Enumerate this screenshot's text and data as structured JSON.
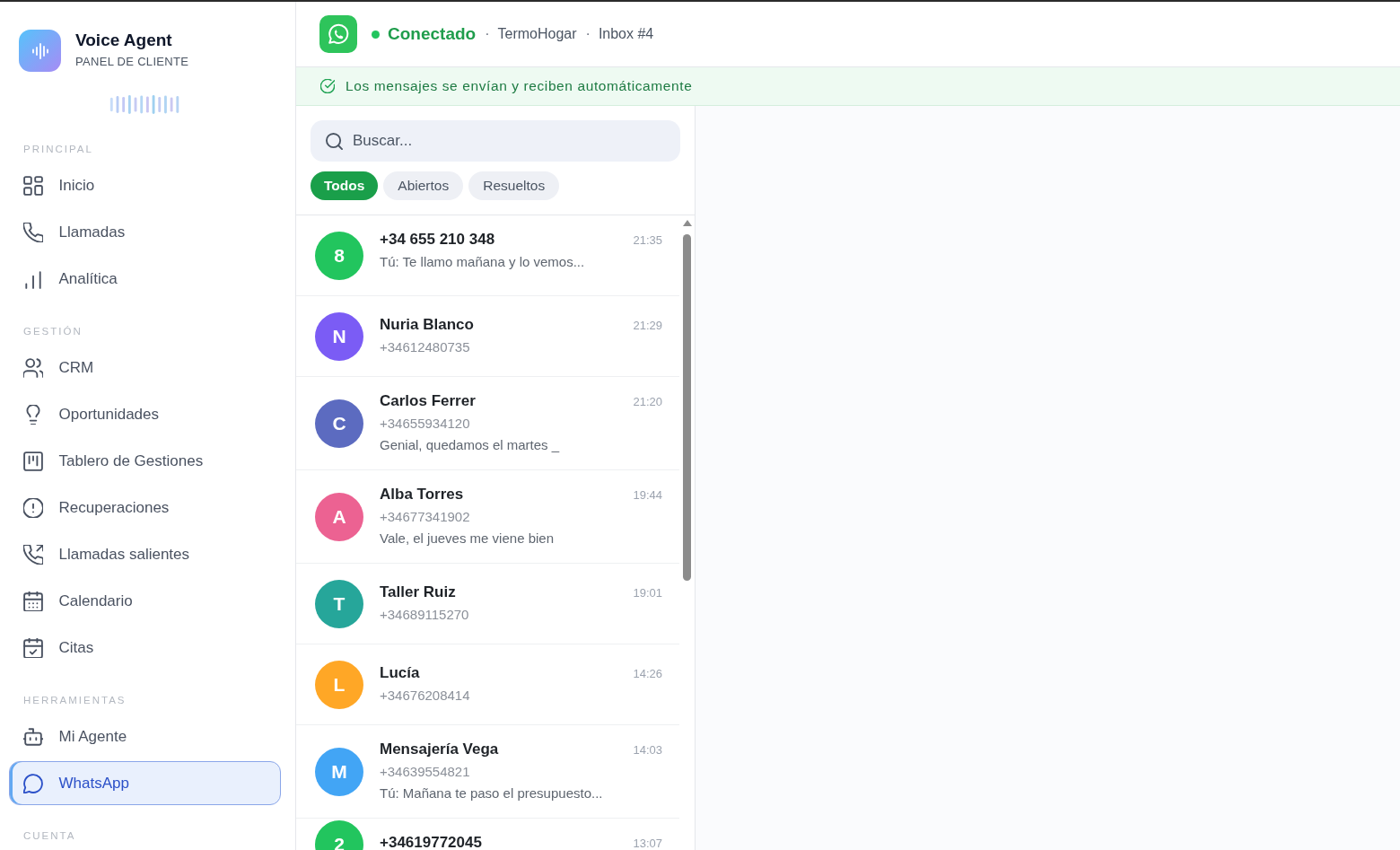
{
  "sidebar": {
    "brand": {
      "title": "Voice Agent",
      "subtitle": "PANEL DE CLIENTE"
    },
    "sections": [
      {
        "label": "PRINCIPAL",
        "items": [
          {
            "label": "Inicio",
            "selected": false
          },
          {
            "label": "Llamadas",
            "selected": false
          },
          {
            "label": "Analítica",
            "selected": false
          }
        ]
      },
      {
        "label": "GESTIÓN",
        "items": [
          {
            "label": "CRM",
            "selected": false
          },
          {
            "label": "Oportunidades",
            "selected": false
          },
          {
            "label": "Tablero de Gestiones",
            "selected": false
          },
          {
            "label": "Recuperaciones",
            "selected": false
          },
          {
            "label": "Llamadas salientes",
            "selected": false
          },
          {
            "label": "Calendario",
            "selected": false
          },
          {
            "label": "Citas",
            "selected": false
          }
        ]
      },
      {
        "label": "HERRAMIENTAS",
        "items": [
          {
            "label": "Mi Agente",
            "selected": false
          },
          {
            "label": "WhatsApp",
            "selected": true
          }
        ]
      },
      {
        "label": "CUENTA"
      }
    ]
  },
  "header": {
    "status": "Conectado",
    "connected": true,
    "breadcrumb": [
      {
        "separator": "·",
        "text": "TermoHogar"
      },
      {
        "separator": "·",
        "text": "Inbox #4"
      }
    ]
  },
  "banner": {
    "text": "Los mensajes se envían y reciben automáticamente"
  },
  "search": {
    "placeholder": "Buscar..."
  },
  "filters": [
    {
      "label": "Todos",
      "selected": true
    },
    {
      "label": "Abiertos",
      "selected": false
    },
    {
      "label": "Resueltos",
      "selected": false
    }
  ],
  "conversations": [
    {
      "initial": "8",
      "color": "#22c55e",
      "name": "+34 655 210 348",
      "time": "21:35",
      "preview": "Tú: Te llamo mañana y lo vemos..."
    },
    {
      "initial": "N",
      "color": "#7b5cf5",
      "name": "Nuria Blanco",
      "time": "21:29",
      "phone": "+34612480735"
    },
    {
      "initial": "C",
      "color": "#5c6bc0",
      "name": "Carlos Ferrer",
      "time": "21:20",
      "phone": "+34655934120",
      "preview": "Genial, quedamos el martes _"
    },
    {
      "initial": "A",
      "color": "#ec6292",
      "name": "Alba Torres",
      "time": "19:44",
      "phone": "+34677341902",
      "preview": "Vale, el jueves me viene bien"
    },
    {
      "initial": "T",
      "color": "#26a69a",
      "name": "Taller Ruiz",
      "time": "19:01",
      "phone": "+34689115270"
    },
    {
      "initial": "L",
      "color": "#ffa726",
      "name": "Lucía",
      "time": "14:26",
      "phone": "+34676208414"
    },
    {
      "initial": "M",
      "color": "#42a5f5",
      "name": "Mensajería Vega",
      "time": "14:03",
      "phone": "+34639554821",
      "preview": "Tú: Mañana te paso el presupuesto..."
    },
    {
      "initial": "2",
      "color": "#22c55e",
      "name": "+34619772045",
      "time": "13:07"
    }
  ]
}
